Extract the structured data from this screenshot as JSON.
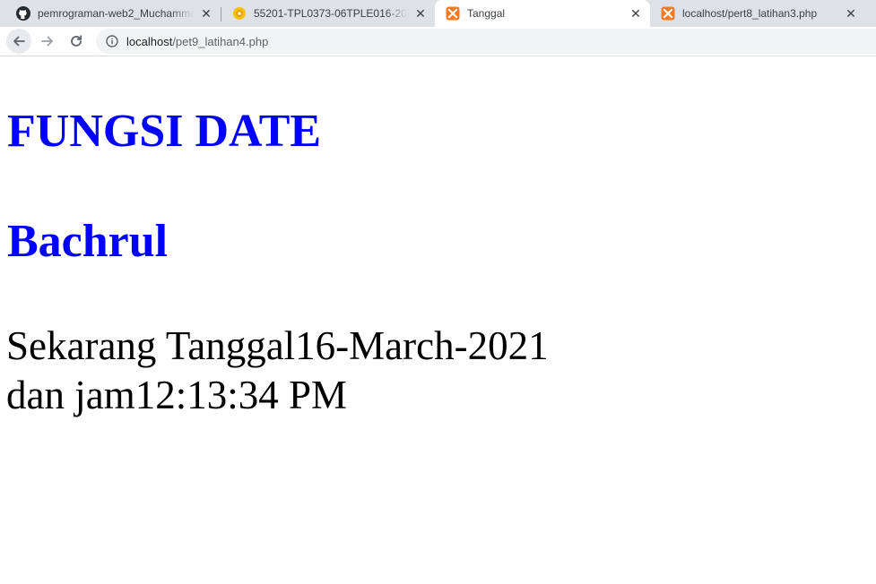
{
  "tabs": [
    {
      "title": "pemrograman-web2_Muchammad",
      "icon": "github-icon",
      "active": false
    },
    {
      "title": "55201-TPL0373-06TPLE016-2020",
      "icon": "elearning-icon",
      "active": false
    },
    {
      "title": "Tanggal",
      "icon": "xampp-icon",
      "active": true
    },
    {
      "title": "localhost/pert8_latihan3.php",
      "icon": "xampp-icon",
      "active": false
    }
  ],
  "address_bar": {
    "host": "localhost",
    "path": "/pet9_latihan4.php"
  },
  "page": {
    "heading": "FUNGSI DATE",
    "subheading": "Bachrul",
    "date_line": "Sekarang Tanggal16-March-2021",
    "time_line": "dan jam12:13:34 PM"
  },
  "colors": {
    "heading": "#0000ff",
    "text": "#000000",
    "tabstrip": "#dee1e6",
    "xampp_orange": "#fb7a24"
  }
}
